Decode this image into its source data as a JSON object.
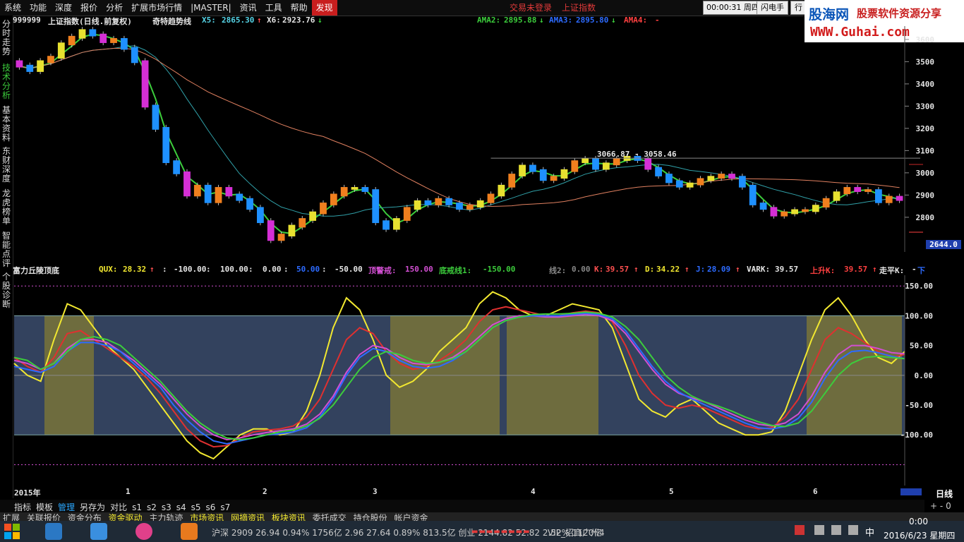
{
  "menu": {
    "items": [
      "系统",
      "功能",
      "深度",
      "报价",
      "分析",
      "扩展市场行情",
      "|MASTER|",
      "资讯",
      "工具",
      "帮助"
    ],
    "active": "发现",
    "login_alert": "交易未登录",
    "index_link": "上证指数",
    "clock": "00:00:31",
    "weekday": "周四",
    "btn_flash": "闪电手",
    "btn_trade": "行"
  },
  "logo": {
    "name": "股海网",
    "slogan": "股票软件资源分享",
    "url": "WWW.Guhai.com"
  },
  "sidebar": {
    "tabs": [
      {
        "label": "分时走势"
      },
      {
        "label": "技术分析"
      },
      {
        "label": "基本资料"
      },
      {
        "label": "东财深度"
      },
      {
        "label": "龙虎榜单"
      },
      {
        "label": "智能点评"
      },
      {
        "label": "个股诊断"
      }
    ]
  },
  "main_header": {
    "code": "999999",
    "name": "上证指数(日线.前复权)",
    "indicator": "奇特趋势线",
    "x5_label": "X5:",
    "x5_value": "2865.30",
    "x6_label": "X6:",
    "x6_value": "2923.76",
    "ama2_label": "AMA2:",
    "ama2_value": "2895.88",
    "ama3_label": "AMA3:",
    "ama3_value": "2895.80",
    "ama4_label": "AMA4:",
    "ama4_value": "-"
  },
  "sub_header": {
    "name": "富力丘陵顶底",
    "qux_label": "QUX:",
    "qux_value": "28.32",
    "c1": "-100.00",
    "c2": "100.00",
    "c3": "0.00",
    "c4": "50.00",
    "c5": "-50.00",
    "top_warn_label": "顶警戒:",
    "top_warn_value": "150.00",
    "bot_warn_label": "底戒线1:",
    "bot_warn_value": "-150.00",
    "line2_label": "线2:",
    "line2_value": "0.00",
    "k_label": "K:",
    "k_value": "39.57",
    "d_label": "D:",
    "d_value": "34.22",
    "j_label": "J:",
    "j_value": "28.09",
    "vark_label": "VARK:",
    "vark_value": "39.57",
    "upk_label": "上升K:",
    "upk_value": "39.57",
    "flatk_label": "走平K:",
    "flatk_value": "-",
    "down_label": "下"
  },
  "chart_data": [
    {
      "type": "candlestick",
      "y_ticks": [
        2800,
        2900,
        3000,
        3100,
        3200,
        3300,
        3400,
        3500,
        3600
      ],
      "ylim": [
        2644,
        3660
      ],
      "low_label": "2644.0",
      "high_annotation": "3066.87 - 3058.46",
      "x_labels": [
        "2015年",
        "1",
        "2",
        "3",
        "4",
        "5",
        "6"
      ],
      "period_label": "日线",
      "close": [
        3480,
        3460,
        3500,
        3520,
        3580,
        3610,
        3640,
        3620,
        3590,
        3600,
        3560,
        3500,
        3300,
        3200,
        3050,
        3000,
        2900,
        2940,
        2870,
        2930,
        2900,
        2880,
        2840,
        2780,
        2700,
        2720,
        2760,
        2790,
        2820,
        2860,
        2900,
        2930,
        2930,
        2920,
        2780,
        2750,
        2790,
        2840,
        2870,
        2860,
        2880,
        2860,
        2840,
        2850,
        2870,
        2900,
        2940,
        2990,
        3030,
        3010,
        2970,
        2980,
        3010,
        3050,
        3060,
        3020,
        3040,
        3060,
        3070,
        3060,
        3020,
        2990,
        2960,
        2940,
        2950,
        2970,
        2980,
        2990,
        2980,
        2940,
        2860,
        2840,
        2810,
        2820,
        2830,
        2830,
        2850,
        2880,
        2910,
        2930,
        2920,
        2920,
        2870,
        2890,
        2880
      ]
    },
    {
      "type": "oscillator",
      "y_ticks": [
        -100,
        -50,
        0,
        50,
        100,
        150
      ],
      "ylim": [
        -185,
        168
      ],
      "series": [
        {
          "name": "QUX",
          "values": [
            20,
            0,
            -10,
            60,
            120,
            110,
            80,
            50,
            30,
            10,
            -20,
            -50,
            -80,
            -110,
            -130,
            -140,
            -120,
            -100,
            -90,
            -90,
            -100,
            -95,
            -60,
            0,
            80,
            130,
            110,
            60,
            0,
            -20,
            -10,
            10,
            40,
            60,
            80,
            120,
            140,
            130,
            110,
            100,
            100,
            110,
            120,
            115,
            110,
            80,
            20,
            -40,
            -60,
            -70,
            -50,
            -40,
            -60,
            -80,
            -90,
            -100,
            -100,
            -95,
            -60,
            0,
            60,
            110,
            130,
            100,
            60,
            30,
            20,
            40
          ]
        },
        {
          "name": "K",
          "values": [
            30,
            15,
            5,
            30,
            70,
            75,
            60,
            45,
            30,
            15,
            -5,
            -30,
            -60,
            -90,
            -110,
            -120,
            -118,
            -105,
            -95,
            -92,
            -90,
            -85,
            -70,
            -40,
            10,
            60,
            80,
            70,
            40,
            20,
            10,
            15,
            25,
            40,
            60,
            90,
            110,
            115,
            110,
            105,
            100,
            100,
            105,
            108,
            105,
            90,
            50,
            0,
            -30,
            -50,
            -55,
            -50,
            -55,
            -65,
            -75,
            -85,
            -90,
            -88,
            -70,
            -40,
            10,
            60,
            80,
            70,
            55,
            40,
            30,
            35
          ]
        },
        {
          "name": "D",
          "values": [
            25,
            20,
            10,
            20,
            45,
            60,
            60,
            55,
            40,
            25,
            5,
            -15,
            -40,
            -65,
            -85,
            -100,
            -108,
            -105,
            -100,
            -96,
            -93,
            -90,
            -82,
            -65,
            -35,
            5,
            35,
            50,
            45,
            30,
            20,
            18,
            22,
            30,
            45,
            65,
            85,
            95,
            100,
            100,
            98,
            98,
            100,
            102,
            100,
            92,
            70,
            40,
            10,
            -15,
            -30,
            -38,
            -45,
            -55,
            -65,
            -75,
            -82,
            -85,
            -80,
            -65,
            -35,
            5,
            35,
            50,
            50,
            45,
            38,
            36
          ]
        },
        {
          "name": "J",
          "values": [
            15,
            10,
            5,
            15,
            40,
            55,
            55,
            50,
            40,
            20,
            0,
            -20,
            -50,
            -75,
            -95,
            -110,
            -115,
            -110,
            -105,
            -100,
            -98,
            -95,
            -88,
            -70,
            -40,
            0,
            30,
            45,
            40,
            25,
            15,
            12,
            15,
            25,
            40,
            60,
            80,
            92,
            98,
            100,
            100,
            100,
            102,
            104,
            102,
            95,
            75,
            45,
            15,
            -10,
            -28,
            -40,
            -50,
            -60,
            -70,
            -80,
            -88,
            -90,
            -86,
            -72,
            -45,
            -5,
            25,
            40,
            42,
            38,
            32,
            28
          ]
        },
        {
          "name": "VARK",
          "values": [
            30,
            25,
            10,
            20,
            40,
            60,
            65,
            60,
            50,
            30,
            10,
            -10,
            -35,
            -60,
            -80,
            -95,
            -105,
            -108,
            -105,
            -100,
            -95,
            -92,
            -85,
            -72,
            -50,
            -20,
            10,
            30,
            40,
            35,
            25,
            20,
            22,
            28,
            40,
            60,
            80,
            92,
            98,
            102,
            103,
            103,
            104,
            106,
            104,
            98,
            82,
            60,
            30,
            0,
            -20,
            -35,
            -45,
            -52,
            -60,
            -70,
            -78,
            -84,
            -86,
            -80,
            -60,
            -30,
            0,
            20,
            30,
            32,
            30,
            28
          ]
        }
      ]
    }
  ],
  "bottom_nav": [
    "指标",
    "模板",
    "管理",
    "另存为",
    "对比",
    "s1",
    "s2",
    "s3",
    "s4",
    "s5",
    "s6",
    "s7"
  ],
  "bottom_nav_selected": "管理",
  "info_bar": {
    "expand": "扩展",
    "tabs": [
      "关联报价",
      "资金分布",
      "资金驱动",
      "主力轨迹",
      "市场资讯",
      "网摘资讯",
      "板块资讯",
      "委托成交",
      "持仓股份",
      "帐户资金"
    ],
    "quotes": "沪深 2909 26.94 0.94% 1756亿 2.96 27.64 0.89% 813.5亿 创业 2144.82 52.82 2.52% 1120亿",
    "vip": "VIP_招商广州4"
  },
  "taskbar": {
    "time": "0:00",
    "date": "2016/6/23 星期四",
    "ime": "中"
  }
}
